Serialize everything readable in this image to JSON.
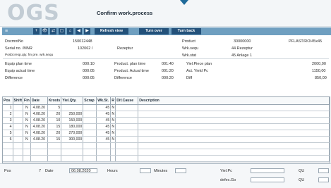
{
  "app": {
    "logo": "OGS",
    "title": "Confirm work.process"
  },
  "toolbar": {
    "menu_label": "≡",
    "icons": [
      "+",
      "👁",
      "⇄",
      "▢",
      "⌂",
      "◀",
      "▶"
    ],
    "refresh_label": "Refresh view",
    "turn_over_label": "Turn over",
    "turn_back_label": "Turn back"
  },
  "info": {
    "docmnt_label": "DocmntNo",
    "docmnt_value": "150012448",
    "serial_label": "Serial no. /MNR",
    "serial_value": "102062 /",
    "rezeptur_label": "Rezeptur",
    "posbl_label": "Posbl.resp.qty. fm pre. wrk.sequ",
    "equip_plan_label": "Equip plan time",
    "equip_plan_value": "000:10",
    "equip_actual_label": "Equip actual time",
    "equip_actual_value": "000:05",
    "diff1_label": "Difference",
    "diff1_value": "000:05",
    "prod_plan_label": "Product. plan time",
    "prod_plan_value": "001:40",
    "prod_actual_label": "Product. Actual time",
    "prod_actual_value": "001:20",
    "diff2_label": "Difference",
    "diff2_value": "000:20",
    "product_label": "Product",
    "product_value": "30000000",
    "product_code": "PFLAST/RO/45x45",
    "wrk_sequ_label": "Wrk.sequ",
    "wrk_sequ_value": "44 Rezeptur",
    "wrk_stat_label": "Wrk.stat",
    "wrk_stat_value": "45 Anlage 1",
    "yiel_label": "Yiel.Piece plan",
    "yiel_value": "2000,00",
    "act_yield_label": "Act. Yield Pc",
    "act_yield_value": "1150,00",
    "diff_label": "Diff",
    "diff_value": "850,00"
  },
  "grid": {
    "headers": [
      "Pos",
      "Shift",
      "Fin",
      "Date",
      "Krosts",
      "Yiel.Qty.",
      "Scrap",
      "Wk.St.",
      "R",
      "Dif.Cause",
      "Description"
    ],
    "rows": [
      [
        "1",
        "",
        "N",
        "4.08.20",
        "5",
        "",
        "",
        "45",
        "N",
        "",
        ""
      ],
      [
        "2",
        "",
        "N",
        "4.08.20",
        "20",
        "250,000",
        "",
        "45",
        "N",
        "",
        ""
      ],
      [
        "3",
        "",
        "N",
        "4.08.20",
        "10",
        "150,000",
        "",
        "45",
        "N",
        "",
        ""
      ],
      [
        "4",
        "",
        "N",
        "4.08.20",
        "15",
        "180,000",
        "",
        "45",
        "N",
        "",
        ""
      ],
      [
        "5",
        "",
        "N",
        "4.08.20",
        "20",
        "270,000",
        "",
        "45",
        "N",
        "",
        ""
      ],
      [
        "6",
        "",
        "N",
        "4.08.20",
        "15",
        "300,000",
        "",
        "45",
        "N",
        "",
        ""
      ]
    ]
  },
  "bottom": {
    "pos_label": "Pos",
    "pos_value": "7",
    "date_label": "Date",
    "date_value": "06.08.2020",
    "hours_label": "Hours",
    "minutes_label": "Minutes",
    "yiel_label": "Yiel.Pc",
    "qu_label": "QU",
    "defec_label": "defec.Go",
    "qu2_label": "QU"
  }
}
